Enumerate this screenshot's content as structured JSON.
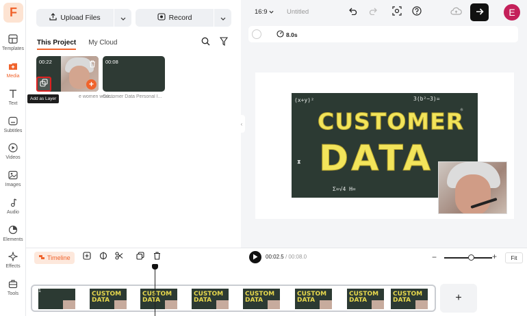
{
  "sidebar": {
    "logo": "F",
    "items": [
      {
        "label": "Templates",
        "icon": "templates-icon"
      },
      {
        "label": "Media",
        "icon": "media-icon"
      },
      {
        "label": "Text",
        "icon": "text-icon"
      },
      {
        "label": "Subtitles",
        "icon": "subtitles-icon"
      },
      {
        "label": "Videos",
        "icon": "videos-icon"
      },
      {
        "label": "Images",
        "icon": "images-icon"
      },
      {
        "label": "Audio",
        "icon": "audio-icon"
      },
      {
        "label": "Elements",
        "icon": "elements-icon"
      },
      {
        "label": "Effects",
        "icon": "effects-icon"
      },
      {
        "label": "Tools",
        "icon": "tools-icon"
      }
    ]
  },
  "media_panel": {
    "upload_label": "Upload Files",
    "record_label": "Record",
    "tabs": [
      "This Project",
      "My Cloud"
    ],
    "active_tab": "This Project",
    "items": [
      {
        "duration": "00:22",
        "name": "e women work..."
      },
      {
        "duration": "00:08",
        "name": "Customer Data Personal I..."
      }
    ],
    "tooltip": "Add as Layer"
  },
  "topbar": {
    "aspect_ratio": "16:9",
    "project_title": "Untitled",
    "avatar_initial": "E"
  },
  "canvas_toolbar": {
    "duration": "8.0s"
  },
  "canvas": {
    "board_line1": "CUSTOMER",
    "board_line2": "DATA"
  },
  "timeline": {
    "label": "Timeline",
    "current_time": "00:02.5",
    "total_time": "00:08.0",
    "fit_label": "Fit",
    "track_index": "1",
    "add_label": "+",
    "zoom_level": 0.57
  },
  "colors": {
    "accent": "#f0632c",
    "avatar": "#c4205a",
    "highlight_box": "#e02020"
  }
}
